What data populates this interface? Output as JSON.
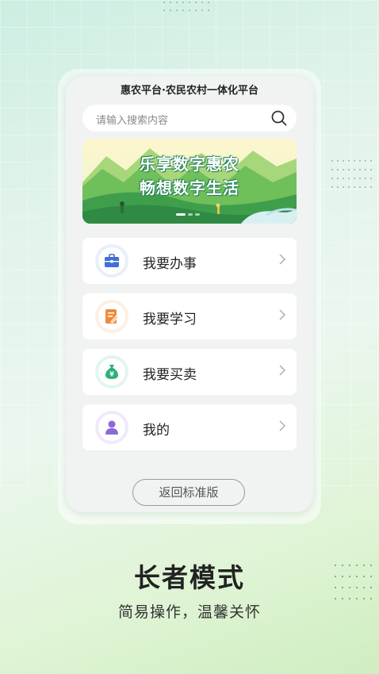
{
  "header": {
    "title": "惠农平台·农民农村一体化平台"
  },
  "search": {
    "placeholder": "请输入搜索内容"
  },
  "banner": {
    "line1": "乐享数字惠农",
    "line2": "畅想数字生活",
    "slide_count": 3,
    "active_slide": 1
  },
  "menu": {
    "items": [
      {
        "label": "我要办事",
        "icon": "briefcase-icon",
        "color": "#3f6fd8"
      },
      {
        "label": "我要学习",
        "icon": "notebook-pen-icon",
        "color": "#ef8a3a"
      },
      {
        "label": "我要买卖",
        "icon": "money-bag-icon",
        "color": "#2fb07a"
      },
      {
        "label": "我的",
        "icon": "user-icon",
        "color": "#8b6ad8"
      }
    ]
  },
  "footer": {
    "back_label": "返回标准版"
  },
  "promo": {
    "title": "长者模式",
    "subtitle": "简易操作，温馨关怀"
  }
}
